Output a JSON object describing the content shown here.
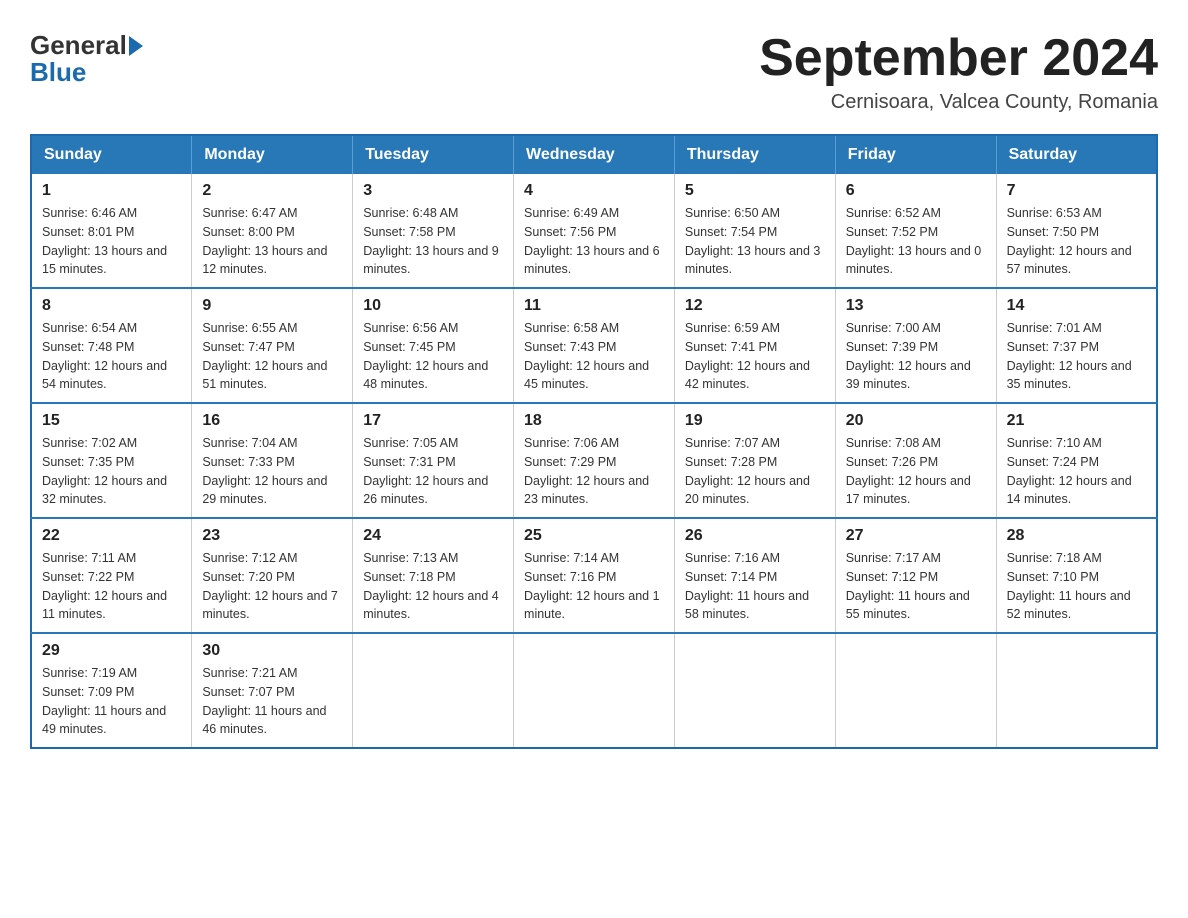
{
  "header": {
    "logo": {
      "general": "General",
      "blue": "Blue"
    },
    "title": "September 2024",
    "subtitle": "Cernisoara, Valcea County, Romania"
  },
  "calendar": {
    "days_of_week": [
      "Sunday",
      "Monday",
      "Tuesday",
      "Wednesday",
      "Thursday",
      "Friday",
      "Saturday"
    ],
    "weeks": [
      [
        {
          "day": "1",
          "sunrise": "6:46 AM",
          "sunset": "8:01 PM",
          "daylight": "13 hours and 15 minutes."
        },
        {
          "day": "2",
          "sunrise": "6:47 AM",
          "sunset": "8:00 PM",
          "daylight": "13 hours and 12 minutes."
        },
        {
          "day": "3",
          "sunrise": "6:48 AM",
          "sunset": "7:58 PM",
          "daylight": "13 hours and 9 minutes."
        },
        {
          "day": "4",
          "sunrise": "6:49 AM",
          "sunset": "7:56 PM",
          "daylight": "13 hours and 6 minutes."
        },
        {
          "day": "5",
          "sunrise": "6:50 AM",
          "sunset": "7:54 PM",
          "daylight": "13 hours and 3 minutes."
        },
        {
          "day": "6",
          "sunrise": "6:52 AM",
          "sunset": "7:52 PM",
          "daylight": "13 hours and 0 minutes."
        },
        {
          "day": "7",
          "sunrise": "6:53 AM",
          "sunset": "7:50 PM",
          "daylight": "12 hours and 57 minutes."
        }
      ],
      [
        {
          "day": "8",
          "sunrise": "6:54 AM",
          "sunset": "7:48 PM",
          "daylight": "12 hours and 54 minutes."
        },
        {
          "day": "9",
          "sunrise": "6:55 AM",
          "sunset": "7:47 PM",
          "daylight": "12 hours and 51 minutes."
        },
        {
          "day": "10",
          "sunrise": "6:56 AM",
          "sunset": "7:45 PM",
          "daylight": "12 hours and 48 minutes."
        },
        {
          "day": "11",
          "sunrise": "6:58 AM",
          "sunset": "7:43 PM",
          "daylight": "12 hours and 45 minutes."
        },
        {
          "day": "12",
          "sunrise": "6:59 AM",
          "sunset": "7:41 PM",
          "daylight": "12 hours and 42 minutes."
        },
        {
          "day": "13",
          "sunrise": "7:00 AM",
          "sunset": "7:39 PM",
          "daylight": "12 hours and 39 minutes."
        },
        {
          "day": "14",
          "sunrise": "7:01 AM",
          "sunset": "7:37 PM",
          "daylight": "12 hours and 35 minutes."
        }
      ],
      [
        {
          "day": "15",
          "sunrise": "7:02 AM",
          "sunset": "7:35 PM",
          "daylight": "12 hours and 32 minutes."
        },
        {
          "day": "16",
          "sunrise": "7:04 AM",
          "sunset": "7:33 PM",
          "daylight": "12 hours and 29 minutes."
        },
        {
          "day": "17",
          "sunrise": "7:05 AM",
          "sunset": "7:31 PM",
          "daylight": "12 hours and 26 minutes."
        },
        {
          "day": "18",
          "sunrise": "7:06 AM",
          "sunset": "7:29 PM",
          "daylight": "12 hours and 23 minutes."
        },
        {
          "day": "19",
          "sunrise": "7:07 AM",
          "sunset": "7:28 PM",
          "daylight": "12 hours and 20 minutes."
        },
        {
          "day": "20",
          "sunrise": "7:08 AM",
          "sunset": "7:26 PM",
          "daylight": "12 hours and 17 minutes."
        },
        {
          "day": "21",
          "sunrise": "7:10 AM",
          "sunset": "7:24 PM",
          "daylight": "12 hours and 14 minutes."
        }
      ],
      [
        {
          "day": "22",
          "sunrise": "7:11 AM",
          "sunset": "7:22 PM",
          "daylight": "12 hours and 11 minutes."
        },
        {
          "day": "23",
          "sunrise": "7:12 AM",
          "sunset": "7:20 PM",
          "daylight": "12 hours and 7 minutes."
        },
        {
          "day": "24",
          "sunrise": "7:13 AM",
          "sunset": "7:18 PM",
          "daylight": "12 hours and 4 minutes."
        },
        {
          "day": "25",
          "sunrise": "7:14 AM",
          "sunset": "7:16 PM",
          "daylight": "12 hours and 1 minute."
        },
        {
          "day": "26",
          "sunrise": "7:16 AM",
          "sunset": "7:14 PM",
          "daylight": "11 hours and 58 minutes."
        },
        {
          "day": "27",
          "sunrise": "7:17 AM",
          "sunset": "7:12 PM",
          "daylight": "11 hours and 55 minutes."
        },
        {
          "day": "28",
          "sunrise": "7:18 AM",
          "sunset": "7:10 PM",
          "daylight": "11 hours and 52 minutes."
        }
      ],
      [
        {
          "day": "29",
          "sunrise": "7:19 AM",
          "sunset": "7:09 PM",
          "daylight": "11 hours and 49 minutes."
        },
        {
          "day": "30",
          "sunrise": "7:21 AM",
          "sunset": "7:07 PM",
          "daylight": "11 hours and 46 minutes."
        },
        null,
        null,
        null,
        null,
        null
      ]
    ]
  }
}
